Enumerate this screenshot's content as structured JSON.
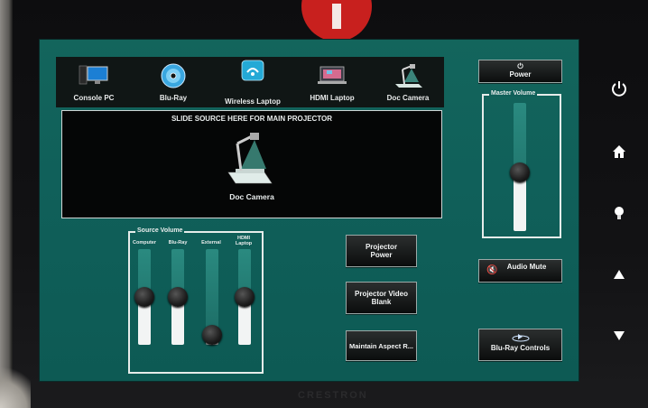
{
  "device": {
    "brand": "CRESTRON"
  },
  "sources": [
    {
      "label": "Console PC",
      "icon": "monitor-pc-icon"
    },
    {
      "label": "Blu-Ray",
      "icon": "disc-icon"
    },
    {
      "label": "Wireless Laptop",
      "icon": "wireless-icon"
    },
    {
      "label": "HDMI Laptop",
      "icon": "laptop-icon"
    },
    {
      "label": "Doc Camera",
      "icon": "doc-camera-icon"
    }
  ],
  "projector": {
    "slide_hint": "SLIDE SOURCE HERE FOR MAIN PROJECTOR",
    "active_source": "Doc Camera"
  },
  "source_volume": {
    "title": "Source Volume",
    "channels": [
      {
        "label": "Computer",
        "level": 0.55
      },
      {
        "label": "Blu-Ray",
        "level": 0.55
      },
      {
        "label": "External",
        "level": 0.05
      },
      {
        "label": "HDMI Laptop",
        "level": 0.55
      }
    ]
  },
  "buttons": {
    "projector_power": "Projector Power",
    "projector_video_blank": "Projector Video Blank",
    "maintain_aspect": "Maintain Aspect R...",
    "power": "Power",
    "audio_mute": "Audio Mute",
    "bluray_controls": "Blu-Ray Controls"
  },
  "master_volume": {
    "title": "Master Volume",
    "level": 0.5
  },
  "side_nav": [
    "power-icon",
    "home-icon",
    "lightbulb-icon",
    "arrow-up-icon",
    "arrow-down-icon"
  ],
  "colors": {
    "screen": "#10605a",
    "accent_red": "#c8201e"
  }
}
